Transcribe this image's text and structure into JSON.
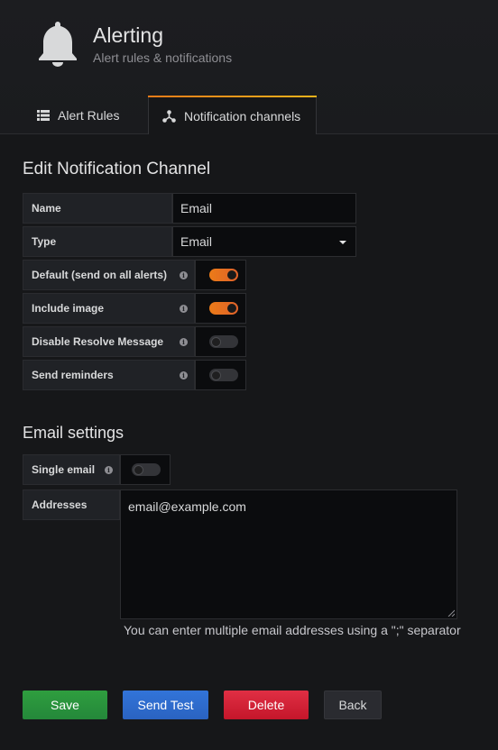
{
  "header": {
    "title": "Alerting",
    "subtitle": "Alert rules & notifications",
    "icon": "bell-icon"
  },
  "tabs": [
    {
      "label": "Alert Rules",
      "icon": "list-icon",
      "active": false
    },
    {
      "label": "Notification channels",
      "icon": "share-nodes-icon",
      "active": true
    }
  ],
  "form": {
    "heading": "Edit Notification Channel",
    "name": {
      "label": "Name",
      "value": "Email"
    },
    "type": {
      "label": "Type",
      "value": "Email"
    },
    "toggles": [
      {
        "label": "Default (send on all alerts)",
        "on": true
      },
      {
        "label": "Include image",
        "on": true
      },
      {
        "label": "Disable Resolve Message",
        "on": false
      },
      {
        "label": "Send reminders",
        "on": false
      }
    ]
  },
  "email_settings": {
    "heading": "Email settings",
    "single_email": {
      "label": "Single email",
      "on": false
    },
    "addresses": {
      "label": "Addresses",
      "value": "email@example.com"
    },
    "hint": "You can enter multiple email addresses using a \";\" separator"
  },
  "buttons": {
    "save": "Save",
    "send_test": "Send Test",
    "delete": "Delete",
    "back": "Back"
  },
  "colors": {
    "accent_orange": "#eb7b18",
    "save_green": "#299c46",
    "test_blue": "#3274d9",
    "delete_red": "#d44a3a"
  }
}
